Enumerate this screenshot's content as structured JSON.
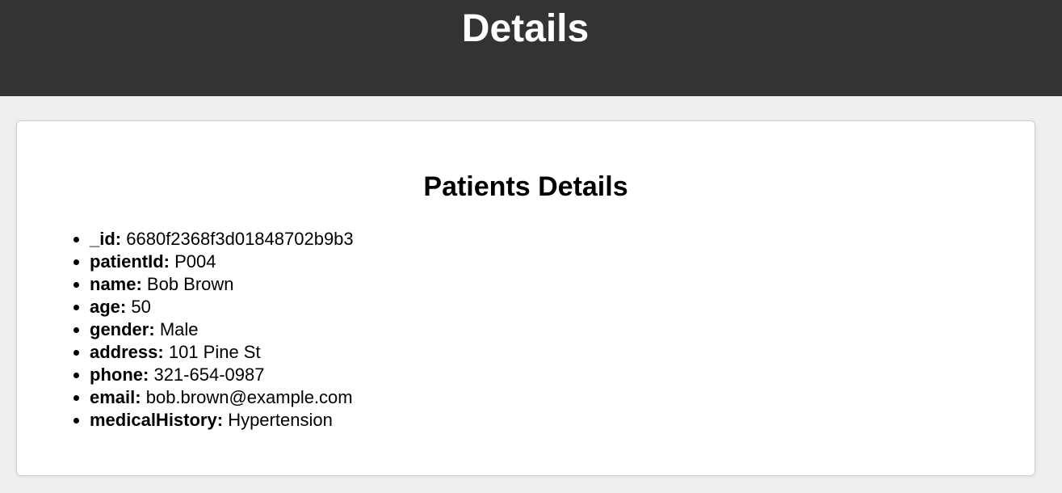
{
  "header": {
    "title": "Details"
  },
  "card": {
    "heading": "Patients Details",
    "fields": [
      {
        "label": "_id:",
        "value": "6680f2368f3d01848702b9b3"
      },
      {
        "label": "patientId:",
        "value": "P004"
      },
      {
        "label": "name:",
        "value": "Bob Brown"
      },
      {
        "label": "age:",
        "value": "50"
      },
      {
        "label": "gender:",
        "value": "Male"
      },
      {
        "label": "address:",
        "value": "101 Pine St"
      },
      {
        "label": "phone:",
        "value": "321-654-0987"
      },
      {
        "label": "email:",
        "value": "bob.brown@example.com"
      },
      {
        "label": "medicalHistory:",
        "value": "Hypertension"
      }
    ]
  },
  "colors": {
    "header_bg": "#333333",
    "page_bg": "#efefef",
    "card_bg": "#ffffff"
  }
}
